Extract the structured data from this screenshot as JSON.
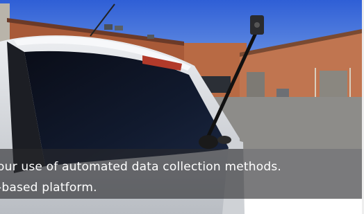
{
  "caption": {
    "line1": "our use of automated data collection methods.",
    "line2": "-based platform."
  },
  "colors": {
    "sky": "#3a67d6",
    "brick": "#b5653f",
    "car_body": "#dfe1e4",
    "window_tint": "#0b0f1c",
    "caption_overlay": "#28282c"
  }
}
